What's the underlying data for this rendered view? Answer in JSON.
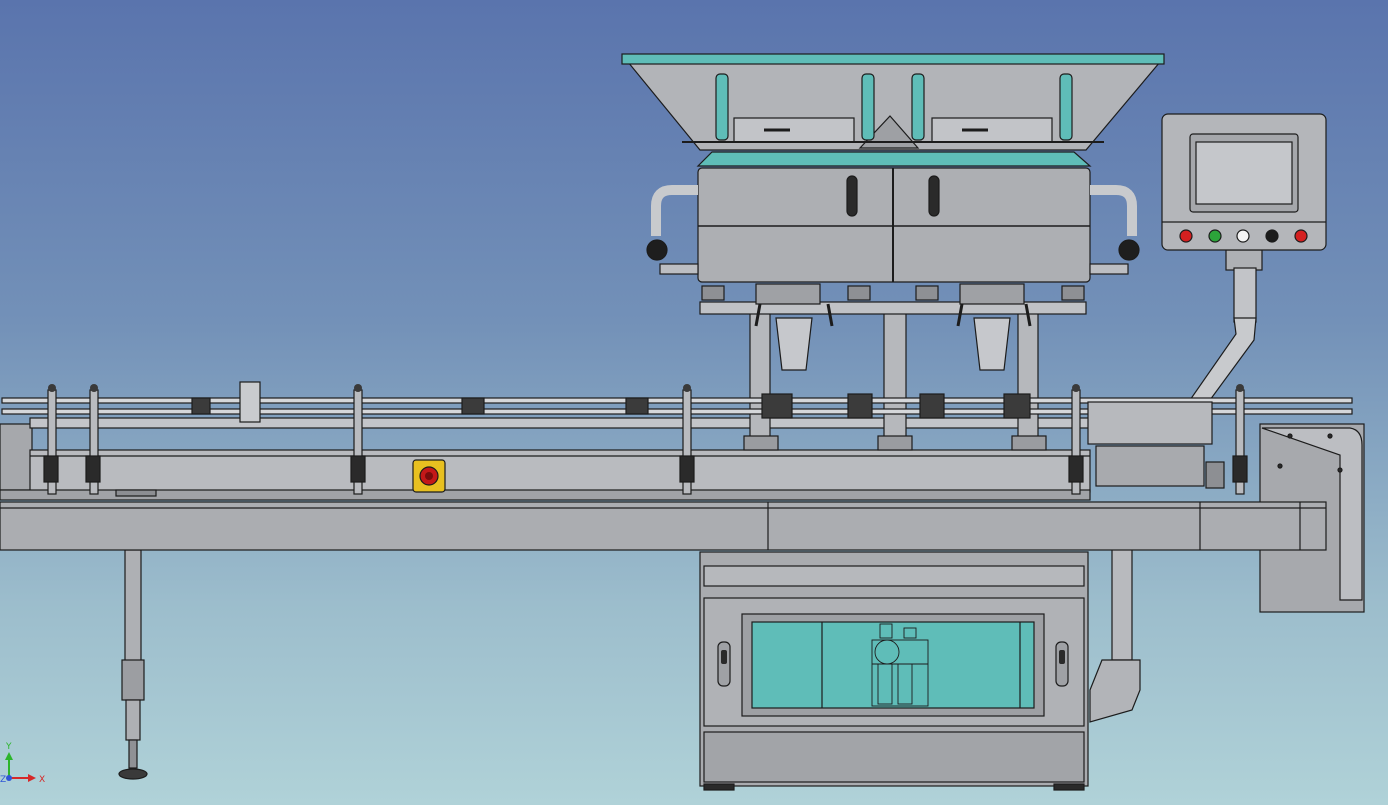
{
  "viewport": {
    "background_top": "#5a74ad",
    "background_bottom": "#b0d2d8"
  },
  "model": {
    "body_color": "#b4b6ba",
    "glass_color": "#5fbdb8",
    "outline_color": "#1c1c1c"
  },
  "control_panel": {
    "indicator_lights": [
      {
        "color": "#d42020"
      },
      {
        "color": "#2ca43a"
      },
      {
        "color": "#f4f4f4"
      },
      {
        "color": "#1b1b1b"
      },
      {
        "color": "#d42020"
      }
    ]
  },
  "emergency_stop": {
    "ring_color": "#e8c020",
    "button_color": "#c41818"
  },
  "axis_triad": {
    "y_label": "Y",
    "z_label": "Z",
    "x_label": "X",
    "y_color": "#2cb52c",
    "z_color": "#2f56d6",
    "x_color": "#d62828"
  }
}
